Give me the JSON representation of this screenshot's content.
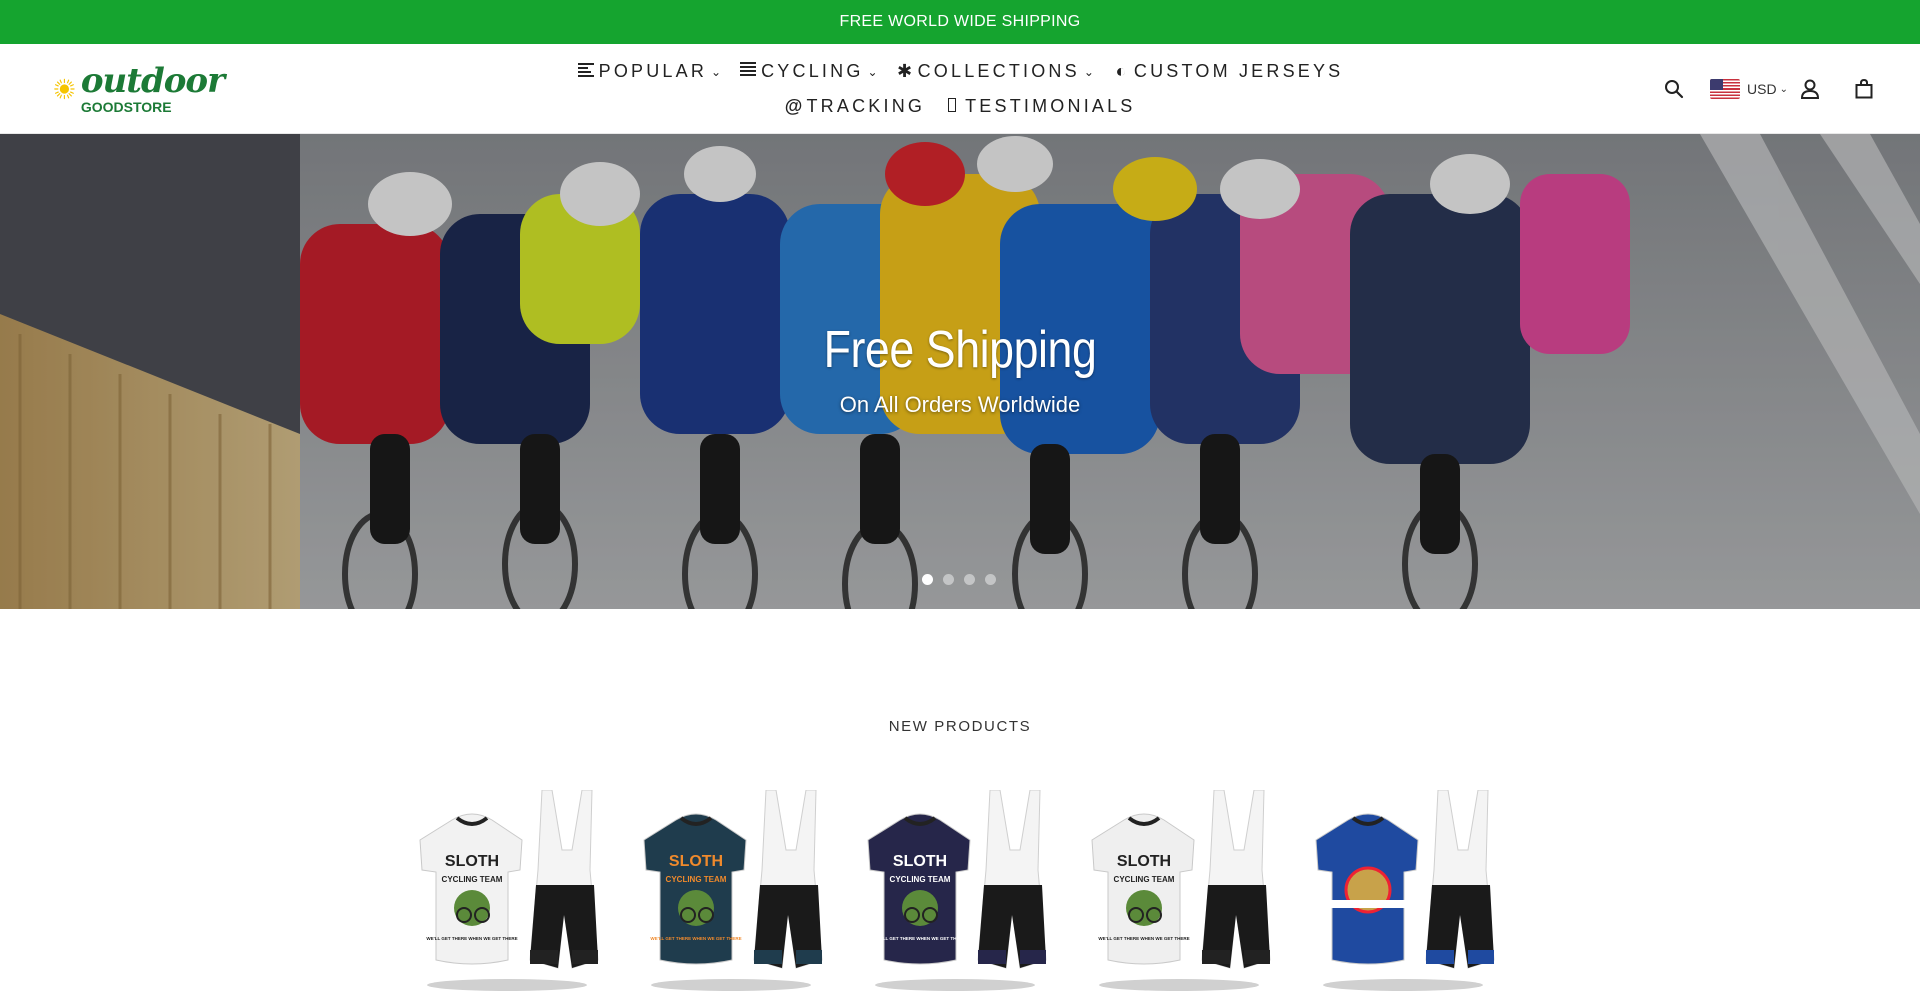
{
  "announcement": {
    "text": "FREE WORLD WIDE SHIPPING"
  },
  "brand": {
    "name_top": "outdoor",
    "name_bottom": "GOODSTORE",
    "accent": "#1c7a36",
    "sun": "#f5c400"
  },
  "nav": {
    "row1": [
      {
        "label": "POPULAR",
        "icon": "text-align-left-icon",
        "has_dropdown": true
      },
      {
        "label": "CYCLING",
        "icon": "list-icon",
        "has_dropdown": true
      },
      {
        "label": "COLLECTIONS",
        "icon": "asterisk-icon",
        "has_dropdown": true
      },
      {
        "label": "CUSTOM JERSEYS",
        "icon": "half-circle-icon",
        "has_dropdown": false
      }
    ],
    "row2": [
      {
        "label": "TRACKING",
        "icon": "at-sign-icon",
        "has_dropdown": false
      },
      {
        "label": "TESTIMONIALS",
        "icon": "missing-glyph-icon",
        "has_dropdown": false
      }
    ]
  },
  "header_actions": {
    "search_icon": "search-icon",
    "currency": "USD",
    "account_icon": "account-icon",
    "cart_icon": "cart-icon"
  },
  "hero": {
    "title": "Free Shipping",
    "subtitle": "On All Orders Worldwide",
    "slides_count": 4,
    "active_slide": 1
  },
  "new_products": {
    "heading": "NEW PRODUCTS",
    "items": [
      {
        "jersey_color": "#f2f2f2",
        "print_top": "SLOTH",
        "print_mid": "CYCLING TEAM",
        "print_bottom": "WE'LL GET THERE WHEN WE GET THERE"
      },
      {
        "jersey_color": "#1f3c4d",
        "print_top": "SLOTH",
        "print_mid": "CYCLING TEAM",
        "print_bottom": "WE'LL GET THERE WHEN WE GET THERE"
      },
      {
        "jersey_color": "#26264a",
        "print_top": "SLOTH",
        "print_mid": "CYCLING TEAM",
        "print_bottom": "WE'LL GET THERE WHEN WE GET THERE"
      },
      {
        "jersey_color": "#efefef",
        "print_top": "SLOTH",
        "print_mid": "CYCLING TEAM",
        "print_bottom": "WE'LL GET THERE WHEN WE GET THERE"
      },
      {
        "jersey_color": "#1f4aa0",
        "print_top": "",
        "print_mid": "",
        "print_bottom": ""
      }
    ]
  },
  "colors": {
    "announcement_bg": "#15a42f",
    "text": "#222222"
  }
}
